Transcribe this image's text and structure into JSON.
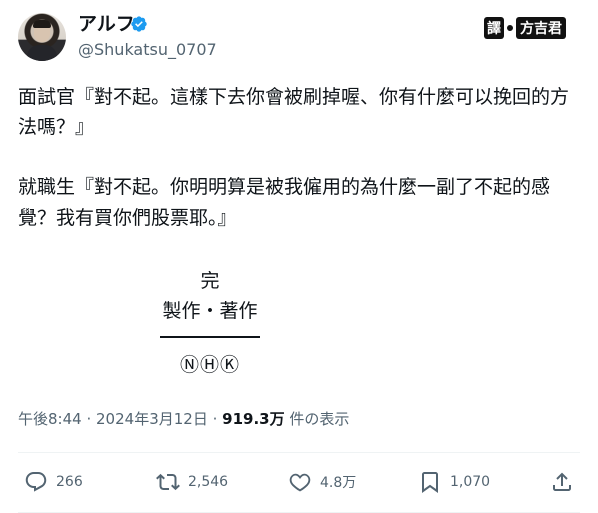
{
  "author": {
    "display_name": "アルフ",
    "handle": "@Shukatsu_0707",
    "verified_icon": "verified-badge-icon"
  },
  "watermark": {
    "part1": "譯",
    "part2": "方吉君"
  },
  "post": {
    "paragraph1": "面試官『對不起。這樣下去你會被刷掉喔、你有什麼可以挽回的方法嗎？』",
    "paragraph2": "就職生『對不起。你明明算是被我僱用的為什麼一副了不起的感覺？我有買你們股票耶。』",
    "credit_end": "完",
    "credit_role": "製作・著作",
    "credit_marks": "ⓃⒽⓀ"
  },
  "meta": {
    "time": "午後8:44",
    "date": "2024年3月12日",
    "views": "919.3万",
    "views_label": "件の表示"
  },
  "actions": {
    "replies": "266",
    "reposts": "2,546",
    "likes": "4.8万",
    "bookmarks": "1,070"
  },
  "colors": {
    "text": "#0f1419",
    "secondary": "#536471",
    "verified": "#1d9bf0"
  }
}
